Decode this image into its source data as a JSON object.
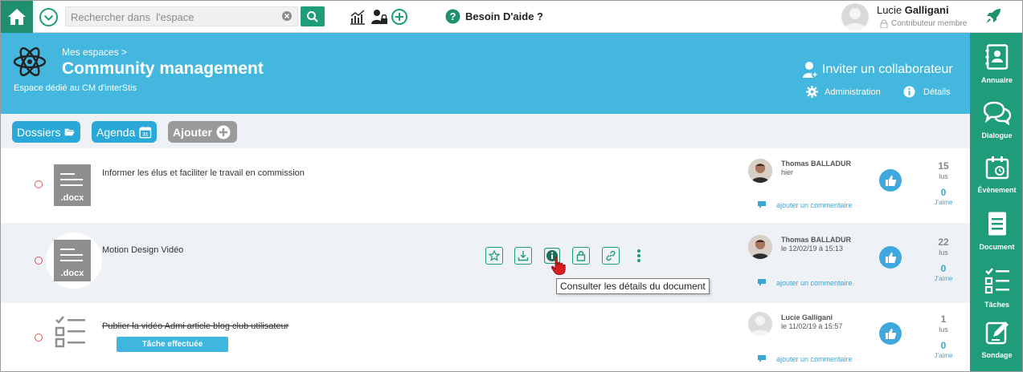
{
  "topbar": {
    "search_placeholder": "Rechercher dans  l'espace",
    "help_label": "Besoin D'aide ?",
    "user_first": "Lucie ",
    "user_last": "Galligani",
    "user_role": "Contributeur membre"
  },
  "space": {
    "breadcrumb": "Mes espaces >",
    "title": "Community management",
    "subtitle": "Espace dédié au CM d'interStis",
    "invite_label": "Inviter un collaborateur",
    "admin_label": "Administration",
    "details_label": "Détails"
  },
  "actions": {
    "folders": "Dossiers",
    "agenda": "Agenda",
    "agenda_day": "31",
    "add": "Ajouter"
  },
  "items": [
    {
      "ext": ".docx",
      "title": "Informer les élus et faciliter le travail en commission",
      "author": "Thomas BALLADUR",
      "when": "hier",
      "comment": "ajouter un commentaire",
      "reads": "15",
      "reads_label": "lus",
      "likes": "0",
      "likes_label": "J'aime"
    },
    {
      "ext": ".docx",
      "title": "Motion Design Vidéo",
      "author": "Thomas BALLADUR",
      "when": "le 12/02/19 à 15:13",
      "comment": "ajouter un commentaire",
      "reads": "22",
      "reads_label": "lus",
      "likes": "0",
      "likes_label": "J'aime",
      "tooltip": "Consulter les détails du document"
    },
    {
      "title": "Publier la vidéo Admi article blog club utilisateur",
      "badge": "Tâche effectuée",
      "author": "Lucie Galligani",
      "when": "le 11/02/19 à 15:57",
      "comment": "ajouter un commentaire",
      "reads": "1",
      "reads_label": "lus",
      "likes": "0",
      "likes_label": "J'aime"
    }
  ],
  "sidebar": {
    "items": [
      {
        "label": "Annuaire",
        "icon": "address-book-icon"
      },
      {
        "label": "Dialogue",
        "icon": "chat-icon"
      },
      {
        "label": "Évènement",
        "icon": "calendar-icon"
      },
      {
        "label": "Document",
        "icon": "document-icon"
      },
      {
        "label": "Tâches",
        "icon": "checklist-icon"
      },
      {
        "label": "Sondage",
        "icon": "poll-icon"
      }
    ]
  },
  "colors": {
    "brand_green": "#1f9c79",
    "header_blue": "#44b7de",
    "accent_blue": "#2aa9d8"
  }
}
